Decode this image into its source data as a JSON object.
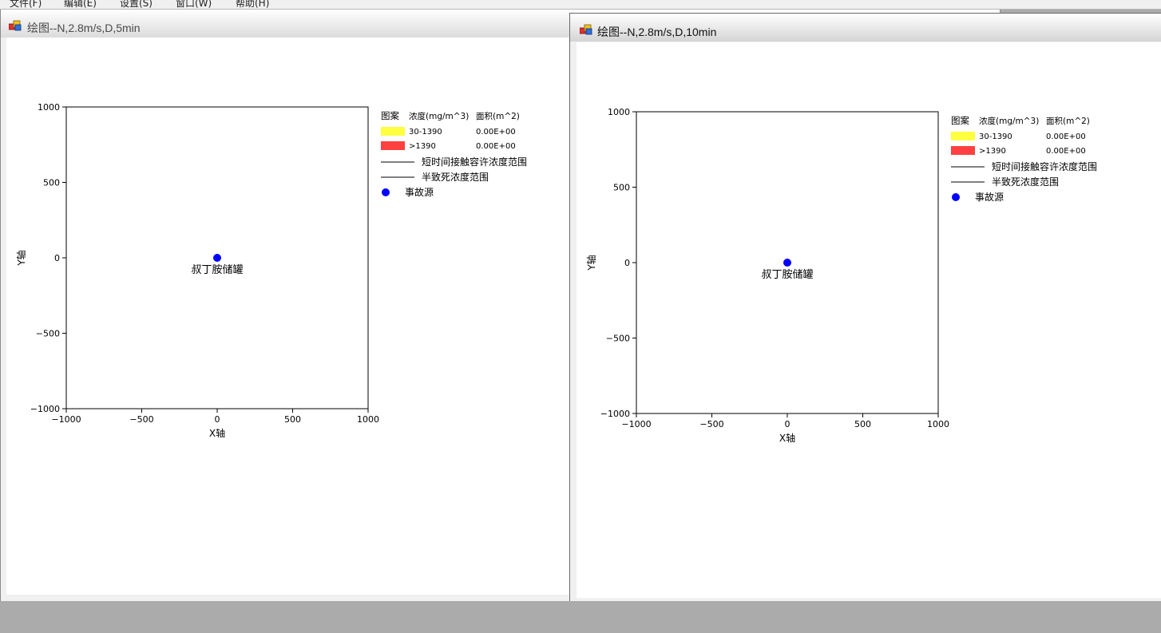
{
  "menubar": {
    "items": [
      "文件(F)",
      "编辑(E)",
      "设置(S)",
      "窗口(W)",
      "帮助(H)"
    ]
  },
  "windows": [
    {
      "title": "绘图--N,2.8m/s,D,5min",
      "chart_data": {
        "type": "scatter",
        "title": "",
        "xlabel": "X轴",
        "ylabel": "Y轴",
        "xlim": [
          -1000,
          1000
        ],
        "ylim": [
          -1000,
          1000
        ],
        "xticks": [
          -1000,
          -500,
          0,
          500,
          1000
        ],
        "yticks": [
          -1000,
          -500,
          0,
          500,
          1000
        ],
        "grid": false,
        "series": [
          {
            "name": "事故源",
            "x": [
              0
            ],
            "y": [
              0
            ],
            "labels": [
              "叔丁胺储罐"
            ]
          }
        ],
        "legend": {
          "placement": "right",
          "headers": [
            "图案",
            "浓度(mg/m^3)",
            "面积(m^2)"
          ],
          "rows": [
            {
              "type": "swatch",
              "color": "#ffff40",
              "range": "30-1390",
              "area": "0.00E+00"
            },
            {
              "type": "swatch",
              "color": "#ff4040",
              "range": ">1390",
              "area": "0.00E+00"
            },
            {
              "type": "line",
              "label": "短时间接触容许浓度范围"
            },
            {
              "type": "line",
              "label": "半致死浓度范围"
            },
            {
              "type": "dot",
              "color": "#0000ff",
              "label": "事故源"
            }
          ]
        }
      }
    },
    {
      "title": "绘图--N,2.8m/s,D,10min",
      "chart_data": {
        "type": "scatter",
        "title": "",
        "xlabel": "X轴",
        "ylabel": "Y轴",
        "xlim": [
          -1000,
          1000
        ],
        "ylim": [
          -1000,
          1000
        ],
        "xticks": [
          -1000,
          -500,
          0,
          500,
          1000
        ],
        "yticks": [
          -1000,
          -500,
          0,
          500,
          1000
        ],
        "grid": false,
        "series": [
          {
            "name": "事故源",
            "x": [
              0
            ],
            "y": [
              0
            ],
            "labels": [
              "叔丁胺储罐"
            ]
          }
        ],
        "legend": {
          "placement": "right",
          "headers": [
            "图案",
            "浓度(mg/m^3)",
            "面积(m^2)"
          ],
          "rows": [
            {
              "type": "swatch",
              "color": "#ffff40",
              "range": "30-1390",
              "area": "0.00E+00"
            },
            {
              "type": "swatch",
              "color": "#ff4040",
              "range": ">1390",
              "area": "0.00E+00"
            },
            {
              "type": "line",
              "label": "短时间接触容许浓度范围"
            },
            {
              "type": "line",
              "label": "半致死浓度范围"
            },
            {
              "type": "dot",
              "color": "#0000ff",
              "label": "事故源"
            }
          ]
        }
      }
    }
  ],
  "icons": {
    "window": "app-window-icon"
  }
}
